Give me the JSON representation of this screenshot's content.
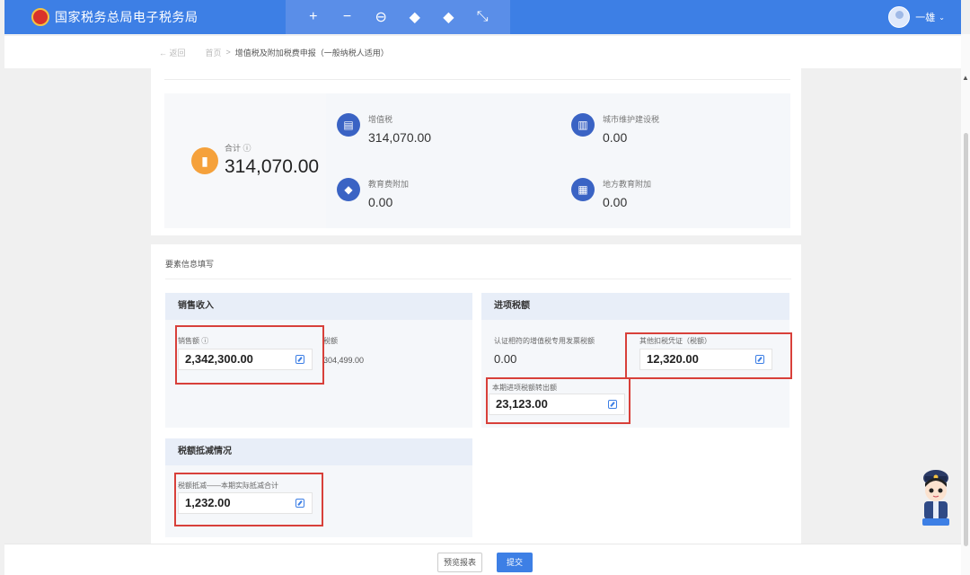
{
  "header": {
    "brand": "国家税务总局电子税务局",
    "tools": [
      "+",
      "−",
      "⊖",
      "◆",
      "◆",
      "⤡"
    ],
    "user_name": "一雄"
  },
  "subnav": {
    "back": "← 返回",
    "home": "首页",
    "separator": ">",
    "current": "增值税及附加税费申报（一般纳税人适用）"
  },
  "summary": {
    "total_label": "合计 ⓘ",
    "total_value": "314,070.00",
    "items": [
      {
        "label": "增值税",
        "value": "314,070.00",
        "icon": "receipt-icon"
      },
      {
        "label": "城市维护建设税",
        "value": "0.00",
        "icon": "building-icon"
      },
      {
        "label": "教育费附加",
        "value": "0.00",
        "icon": "graduation-cap-icon"
      },
      {
        "label": "地方教育附加",
        "value": "0.00",
        "icon": "book-icon"
      }
    ]
  },
  "section_title": "要素信息填写",
  "sales_panel": {
    "title": "销售收入",
    "sales_label": "销售额 ⓘ",
    "sales_value": "2,342,300.00",
    "tax_label": "税额",
    "tax_value": "304,499.00"
  },
  "input_tax_panel": {
    "title": "进项税额",
    "certified_label": "认证相符的增值税专用发票税额",
    "certified_value": "0.00",
    "other_label": "其他扣税凭证（税额）",
    "other_value": "12,320.00",
    "transfer_label": "本期进项税额转出额",
    "transfer_value": "23,123.00"
  },
  "deduction_panel": {
    "title": "税额抵减情况",
    "label": "税额抵减——本期实际抵减合计",
    "value": "1,232.00"
  },
  "footer": {
    "preview": "预览报表",
    "submit": "提交"
  },
  "colors": {
    "header": "#3d7fe5",
    "accent_orange": "#f5a13b",
    "icon_blue": "#3a63c4",
    "highlight_red": "#d8403a"
  }
}
